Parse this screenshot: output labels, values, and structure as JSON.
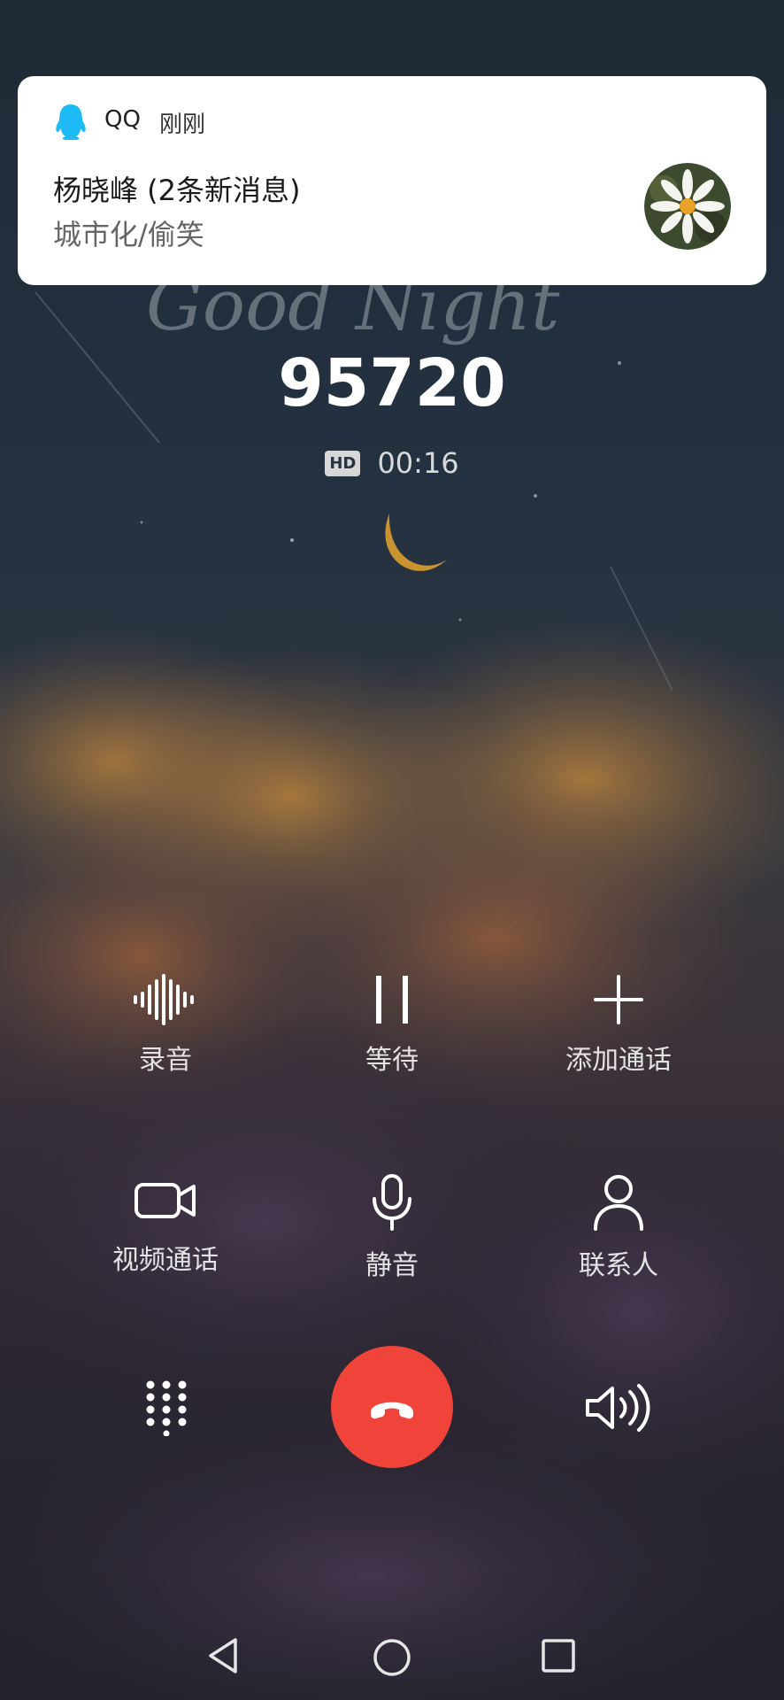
{
  "notification": {
    "app_name": "QQ",
    "time": "刚刚",
    "title": "杨晓峰 (2条新消息)",
    "body": "城市化/偷笑",
    "app_icon": "qq-penguin-icon",
    "avatar": "daisy-avatar"
  },
  "wallpaper": {
    "text": "Good Night"
  },
  "call": {
    "number": "95720",
    "hd_label": "HD",
    "duration": "00:16"
  },
  "controls": {
    "record": "录音",
    "hold": "等待",
    "add_call": "添加通话",
    "video_call": "视频通话",
    "mute": "静音",
    "contacts": "联系人"
  },
  "icons": {
    "keypad": "keypad-icon",
    "end_call": "end-call-icon",
    "speaker": "speaker-icon",
    "back": "back-icon",
    "home": "home-icon",
    "recents": "recents-icon"
  },
  "colors": {
    "end_call": "#f0443a",
    "qq_icon": "#1ebaf5"
  }
}
